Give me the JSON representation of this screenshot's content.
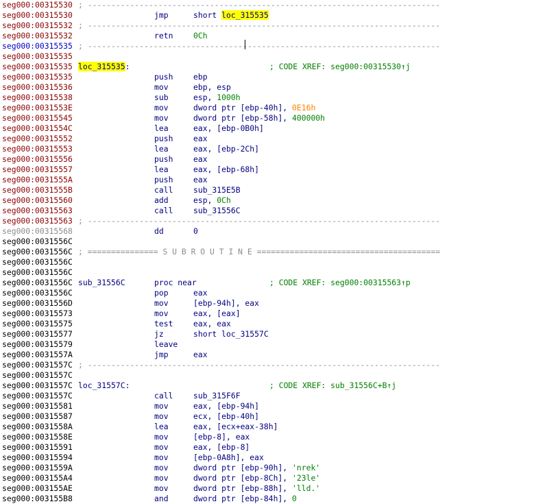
{
  "lines": [
    {
      "addr": "seg000:00315530",
      "ac": "code",
      "sep": "; ---------------------------------------------------------------------------"
    },
    {
      "addr": "seg000:00315530",
      "ac": "code",
      "mn": "jmp",
      "op": [
        {
          "t": "short "
        },
        {
          "t": "loc_315535",
          "c": "hl"
        }
      ]
    },
    {
      "addr": "seg000:00315532",
      "ac": "code",
      "sep": "; ---------------------------------------------------------------------------"
    },
    {
      "addr": "seg000:00315532",
      "ac": "code",
      "mn": "retn",
      "op": [
        {
          "t": "0Ch",
          "c": "num"
        }
      ]
    },
    {
      "addr": "seg000:00315535",
      "ac": "cur",
      "sep": "; ---------------------------------------------------------------------------"
    },
    {
      "addr": "seg000:00315535",
      "ac": "code"
    },
    {
      "addr": "seg000:00315535",
      "ac": "code",
      "label": "loc_315535",
      "hl": true,
      "colon": true,
      "xref": "; CODE XREF: seg000:00315530↑j"
    },
    {
      "addr": "seg000:00315535",
      "ac": "code",
      "mn": "push",
      "op": [
        {
          "t": "ebp"
        }
      ]
    },
    {
      "addr": "seg000:00315536",
      "ac": "code",
      "mn": "mov",
      "op": [
        {
          "t": "ebp, esp"
        }
      ]
    },
    {
      "addr": "seg000:00315538",
      "ac": "code",
      "mn": "sub",
      "op": [
        {
          "t": "esp, "
        },
        {
          "t": "1000h",
          "c": "num"
        }
      ]
    },
    {
      "addr": "seg000:0031553E",
      "ac": "code",
      "mn": "mov",
      "op": [
        {
          "t": "dword ptr [ebp-40h], "
        },
        {
          "t": "0E16h",
          "c": "imm"
        }
      ]
    },
    {
      "addr": "seg000:00315545",
      "ac": "code",
      "mn": "mov",
      "op": [
        {
          "t": "dword ptr [ebp-58h], "
        },
        {
          "t": "400000h",
          "c": "num"
        }
      ]
    },
    {
      "addr": "seg000:0031554C",
      "ac": "code",
      "mn": "lea",
      "op": [
        {
          "t": "eax, [ebp-0B0h]"
        }
      ]
    },
    {
      "addr": "seg000:00315552",
      "ac": "code",
      "mn": "push",
      "op": [
        {
          "t": "eax"
        }
      ]
    },
    {
      "addr": "seg000:00315553",
      "ac": "code",
      "mn": "lea",
      "op": [
        {
          "t": "eax, [ebp-2Ch]"
        }
      ]
    },
    {
      "addr": "seg000:00315556",
      "ac": "code",
      "mn": "push",
      "op": [
        {
          "t": "eax"
        }
      ]
    },
    {
      "addr": "seg000:00315557",
      "ac": "code",
      "mn": "lea",
      "op": [
        {
          "t": "eax, [ebp-68h]"
        }
      ]
    },
    {
      "addr": "seg000:0031555A",
      "ac": "code",
      "mn": "push",
      "op": [
        {
          "t": "eax"
        }
      ]
    },
    {
      "addr": "seg000:0031555B",
      "ac": "code",
      "mn": "call",
      "op": [
        {
          "t": "sub_315E5B"
        }
      ]
    },
    {
      "addr": "seg000:00315560",
      "ac": "code",
      "mn": "add",
      "op": [
        {
          "t": "esp, "
        },
        {
          "t": "0Ch",
          "c": "num"
        }
      ]
    },
    {
      "addr": "seg000:00315563",
      "ac": "code",
      "mn": "call",
      "op": [
        {
          "t": "sub_31556C"
        }
      ]
    },
    {
      "addr": "seg000:00315563",
      "ac": "code",
      "sep": "; ---------------------------------------------------------------------------"
    },
    {
      "addr": "seg000:00315568",
      "ac": "grey",
      "mn": "dd",
      "op": [
        {
          "t": "0"
        }
      ]
    },
    {
      "addr": "seg000:0031556C",
      "ac": "data"
    },
    {
      "addr": "seg000:0031556C",
      "ac": "data",
      "sep": "; =============== S U B R O U T I N E ======================================="
    },
    {
      "addr": "seg000:0031556C",
      "ac": "data"
    },
    {
      "addr": "seg000:0031556C",
      "ac": "data"
    },
    {
      "addr": "seg000:0031556C",
      "ac": "data",
      "label": "sub_31556C",
      "mn": "proc near",
      "xref": "; CODE XREF: seg000:00315563↑p"
    },
    {
      "addr": "seg000:0031556C",
      "ac": "data",
      "mn": "pop",
      "op": [
        {
          "t": "eax"
        }
      ]
    },
    {
      "addr": "seg000:0031556D",
      "ac": "data",
      "mn": "mov",
      "op": [
        {
          "t": "[ebp-94h], eax"
        }
      ]
    },
    {
      "addr": "seg000:00315573",
      "ac": "data",
      "mn": "mov",
      "op": [
        {
          "t": "eax, [eax]"
        }
      ]
    },
    {
      "addr": "seg000:00315575",
      "ac": "data",
      "mn": "test",
      "op": [
        {
          "t": "eax, eax"
        }
      ]
    },
    {
      "addr": "seg000:00315577",
      "ac": "data",
      "mn": "jz",
      "op": [
        {
          "t": "short loc_31557C"
        }
      ]
    },
    {
      "addr": "seg000:00315579",
      "ac": "data",
      "mn": "leave"
    },
    {
      "addr": "seg000:0031557A",
      "ac": "data",
      "mn": "jmp",
      "op": [
        {
          "t": "eax"
        }
      ]
    },
    {
      "addr": "seg000:0031557C",
      "ac": "data",
      "sep": "; ---------------------------------------------------------------------------"
    },
    {
      "addr": "seg000:0031557C",
      "ac": "data"
    },
    {
      "addr": "seg000:0031557C",
      "ac": "data",
      "label": "loc_31557C",
      "colon": true,
      "xref": "; CODE XREF: sub_31556C+B↑j"
    },
    {
      "addr": "seg000:0031557C",
      "ac": "data",
      "mn": "call",
      "op": [
        {
          "t": "sub_315F6F"
        }
      ]
    },
    {
      "addr": "seg000:00315581",
      "ac": "data",
      "mn": "mov",
      "op": [
        {
          "t": "eax, [ebp-94h]"
        }
      ]
    },
    {
      "addr": "seg000:00315587",
      "ac": "data",
      "mn": "mov",
      "op": [
        {
          "t": "ecx, [ebp-40h]"
        }
      ]
    },
    {
      "addr": "seg000:0031558A",
      "ac": "data",
      "mn": "lea",
      "op": [
        {
          "t": "eax, [ecx+eax-38h]"
        }
      ]
    },
    {
      "addr": "seg000:0031558E",
      "ac": "data",
      "mn": "mov",
      "op": [
        {
          "t": "[ebp-8], eax"
        }
      ]
    },
    {
      "addr": "seg000:00315591",
      "ac": "data",
      "mn": "mov",
      "op": [
        {
          "t": "eax, [ebp-8]"
        }
      ]
    },
    {
      "addr": "seg000:00315594",
      "ac": "data",
      "mn": "mov",
      "op": [
        {
          "t": "[ebp-0A8h], eax"
        }
      ]
    },
    {
      "addr": "seg000:0031559A",
      "ac": "data",
      "mn": "mov",
      "op": [
        {
          "t": "dword ptr [ebp-90h], "
        },
        {
          "t": "'nrek'",
          "c": "str"
        }
      ]
    },
    {
      "addr": "seg000:003155A4",
      "ac": "data",
      "mn": "mov",
      "op": [
        {
          "t": "dword ptr [ebp-8Ch], "
        },
        {
          "t": "'23le'",
          "c": "str"
        }
      ]
    },
    {
      "addr": "seg000:003155AE",
      "ac": "data",
      "mn": "mov",
      "op": [
        {
          "t": "dword ptr [ebp-88h], "
        },
        {
          "t": "'lld.'",
          "c": "str"
        }
      ]
    },
    {
      "addr": "seg000:003155B8",
      "ac": "data",
      "mn": "and",
      "op": [
        {
          "t": "dword ptr [ebp-84h], "
        },
        {
          "t": "0",
          "c": "num"
        }
      ]
    }
  ],
  "colors": {
    "address_code": "#8b0000",
    "address_data": "#000000",
    "address_current": "#0000c8",
    "mnemonic": "#000080",
    "comment_xref": "#008000",
    "number": "#008000",
    "immediate_highlight": "#ff8000",
    "label_highlight": "#ffff00"
  }
}
